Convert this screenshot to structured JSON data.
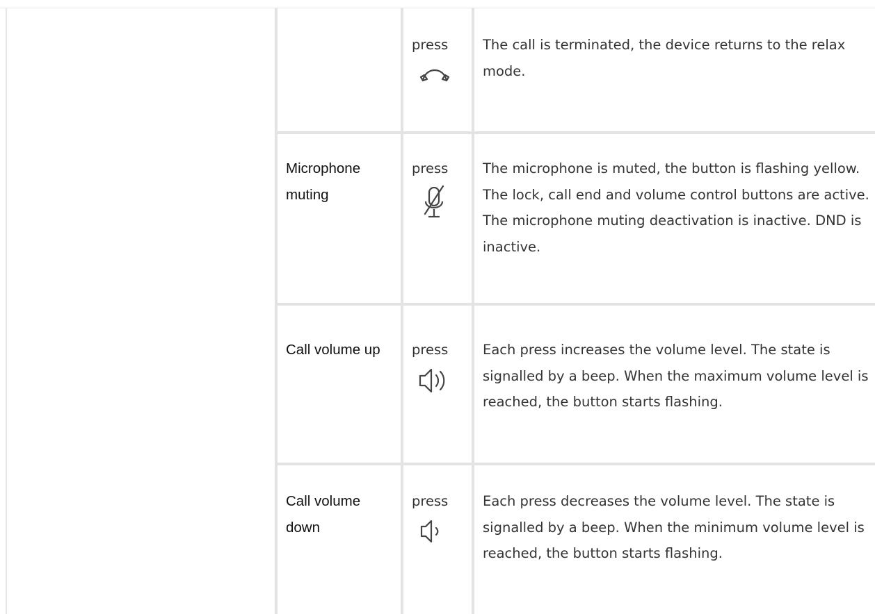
{
  "rows": [
    {
      "feature": "",
      "action": "press",
      "icon": "hang-up-icon",
      "description": "The call is terminated, the device returns to the relax mode."
    },
    {
      "feature": "Microphone muting",
      "action": "press",
      "icon": "microphone-muted-icon",
      "description": "The microphone is muted, the button is flashing yellow. The lock, call end and volume control buttons are active. The microphone muting deactivation is inactive. DND is inactive."
    },
    {
      "feature": "Call volume up",
      "action": "press",
      "icon": "volume-up-icon",
      "description": "Each press increases the volume level. The state is signalled by a beep. When the maximum volume level is reached, the button starts flashing."
    },
    {
      "feature": "Call volume down",
      "action": "press",
      "icon": "volume-down-icon",
      "description": "Each press decreases the volume level. The state is signalled by a beep. When the minimum volume level is reached, the button starts flashing."
    }
  ]
}
